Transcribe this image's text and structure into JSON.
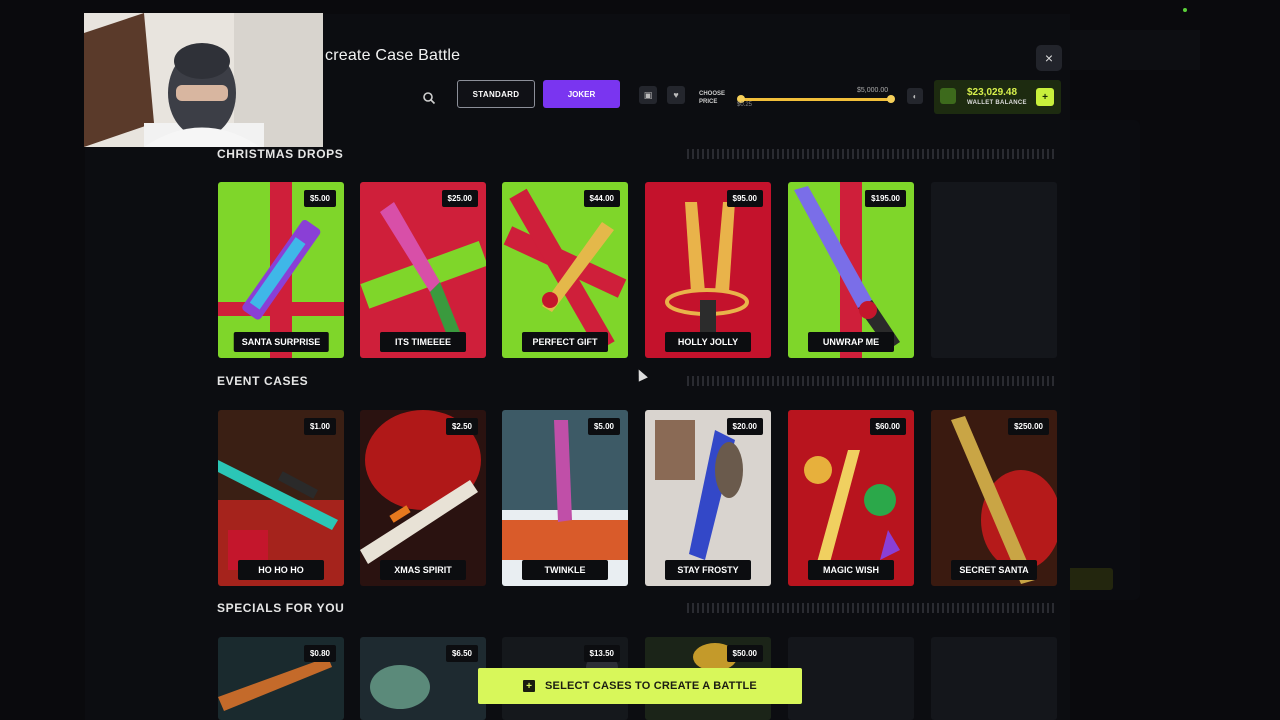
{
  "modal": {
    "title": "create Case Battle",
    "close_label": "×"
  },
  "toolbar": {
    "mode_standard": "STANDARD",
    "mode_joker": "JOKER",
    "choose_price_label": "CHOOSE\nPRICE",
    "price_min": "$0.25",
    "price_max": "$5,000.00",
    "price_range_fraction": [
      0.0,
      1.0
    ]
  },
  "wallet": {
    "amount": "$23,029.48",
    "label": "WALLET BALANCE"
  },
  "sections": [
    {
      "title": "CHRISTMAS DROPS",
      "cases": [
        {
          "name": "SANTA SURPRISE",
          "price": "$5.00"
        },
        {
          "name": "ITS TIMEEEE",
          "price": "$25.00"
        },
        {
          "name": "PERFECT GIFT",
          "price": "$44.00"
        },
        {
          "name": "HOLLY JOLLY",
          "price": "$95.00"
        },
        {
          "name": "UNWRAP ME",
          "price": "$195.00"
        }
      ]
    },
    {
      "title": "EVENT CASES",
      "cases": [
        {
          "name": "HO HO HO",
          "price": "$1.00"
        },
        {
          "name": "XMAS SPIRIT",
          "price": "$2.50"
        },
        {
          "name": "TWINKLE",
          "price": "$5.00"
        },
        {
          "name": "STAY FROSTY",
          "price": "$20.00"
        },
        {
          "name": "MAGIC WISH",
          "price": "$60.00"
        },
        {
          "name": "SECRET SANTA",
          "price": "$250.00"
        }
      ]
    },
    {
      "title": "SPECIALS FOR YOU",
      "cases": [
        {
          "price": "$0.80"
        },
        {
          "price": "$6.50"
        },
        {
          "price": "$13.50"
        },
        {
          "price": "$50.00"
        }
      ]
    }
  ],
  "cta": {
    "label": "SELECT CASES TO CREATE A BATTLE"
  },
  "colors": {
    "accent_lime": "#d8f75a",
    "joker_purple": "#7a35f0",
    "wallet_green": "#d7f04c",
    "gift_green": "#7fd62a",
    "gift_red": "#cf1f3a"
  }
}
